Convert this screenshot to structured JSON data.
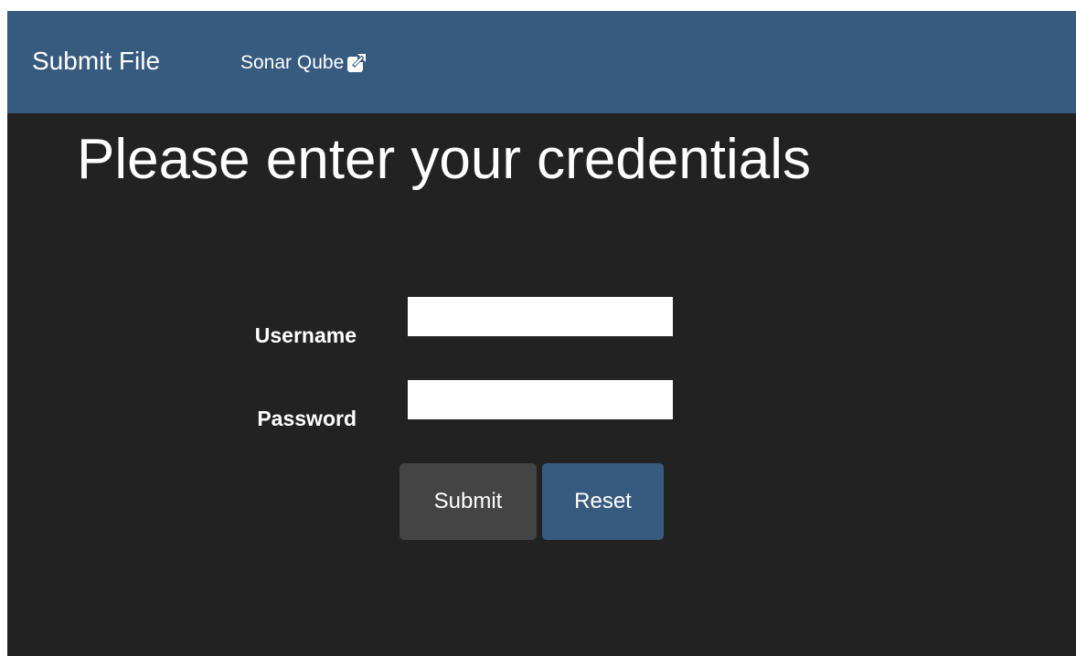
{
  "navbar": {
    "brand": "Submit File",
    "links": [
      {
        "label": "Sonar Qube",
        "icon": "external-link-icon"
      }
    ]
  },
  "page": {
    "heading": "Please enter your credentials"
  },
  "form": {
    "username_label": "Username",
    "username_value": "",
    "password_label": "Password",
    "password_value": "",
    "submit_label": "Submit",
    "reset_label": "Reset"
  },
  "colors": {
    "navbar_bg": "#375a7f",
    "page_bg": "#222222",
    "submit_bg": "#444444",
    "reset_bg": "#375a7f"
  }
}
